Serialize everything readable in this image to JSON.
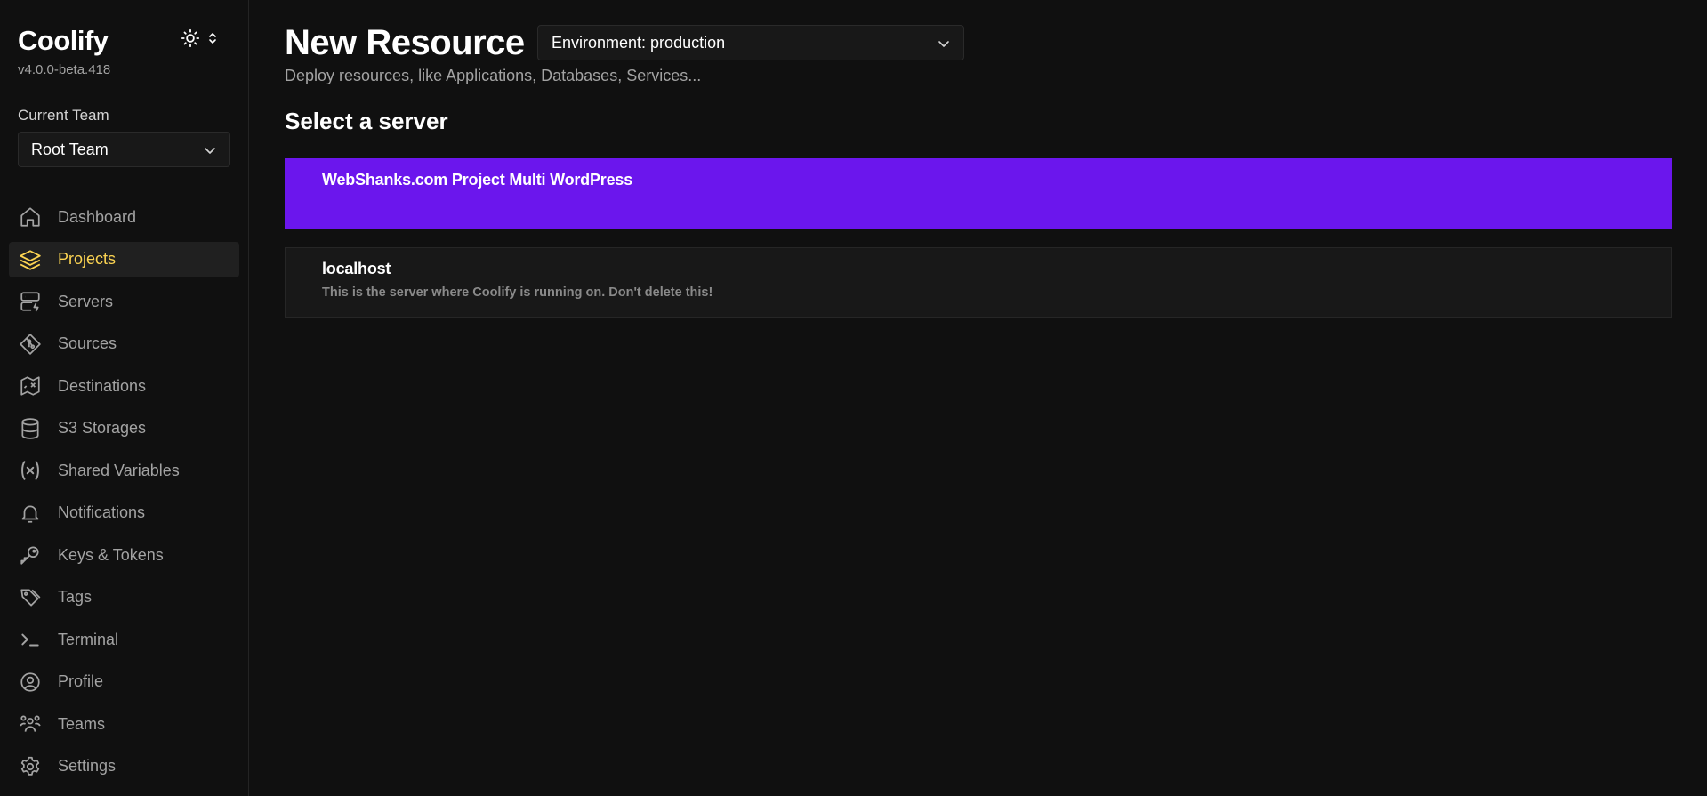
{
  "app": {
    "name": "Coolify",
    "version": "v4.0.0-beta.418"
  },
  "theme_toggle": {
    "icon": "sun-icon",
    "chevron": "chevron-up-down-icon"
  },
  "team": {
    "label": "Current Team",
    "selected": "Root Team"
  },
  "sidebar": {
    "items": [
      {
        "label": "Dashboard",
        "icon": "home-icon",
        "active": false
      },
      {
        "label": "Projects",
        "icon": "layers-icon",
        "active": true
      },
      {
        "label": "Servers",
        "icon": "server-icon",
        "active": false
      },
      {
        "label": "Sources",
        "icon": "git-icon",
        "active": false
      },
      {
        "label": "Destinations",
        "icon": "map-icon",
        "active": false
      },
      {
        "label": "S3 Storages",
        "icon": "database-icon",
        "active": false
      },
      {
        "label": "Shared Variables",
        "icon": "variable-icon",
        "active": false
      },
      {
        "label": "Notifications",
        "icon": "bell-icon",
        "active": false
      },
      {
        "label": "Keys & Tokens",
        "icon": "key-icon",
        "active": false
      },
      {
        "label": "Tags",
        "icon": "tags-icon",
        "active": false
      },
      {
        "label": "Terminal",
        "icon": "terminal-icon",
        "active": false
      },
      {
        "label": "Profile",
        "icon": "user-circle-icon",
        "active": false
      },
      {
        "label": "Teams",
        "icon": "users-icon",
        "active": false
      },
      {
        "label": "Settings",
        "icon": "gear-icon",
        "active": false
      }
    ]
  },
  "page": {
    "title": "New Resource",
    "subtitle": "Deploy resources, like Applications, Databases, Services...",
    "environment_select": "Environment: production",
    "section_title": "Select a server"
  },
  "servers": [
    {
      "name": "WebShanks.com Project Multi WordPress",
      "description": ""
    },
    {
      "name": "localhost",
      "description": "This is the server where Coolify is running on. Don't delete this!"
    }
  ],
  "colors": {
    "background": "#101010",
    "accent_active": "#fcd452",
    "highlight_card": "#6b16ed",
    "muted_text": "#a3a3a3"
  }
}
